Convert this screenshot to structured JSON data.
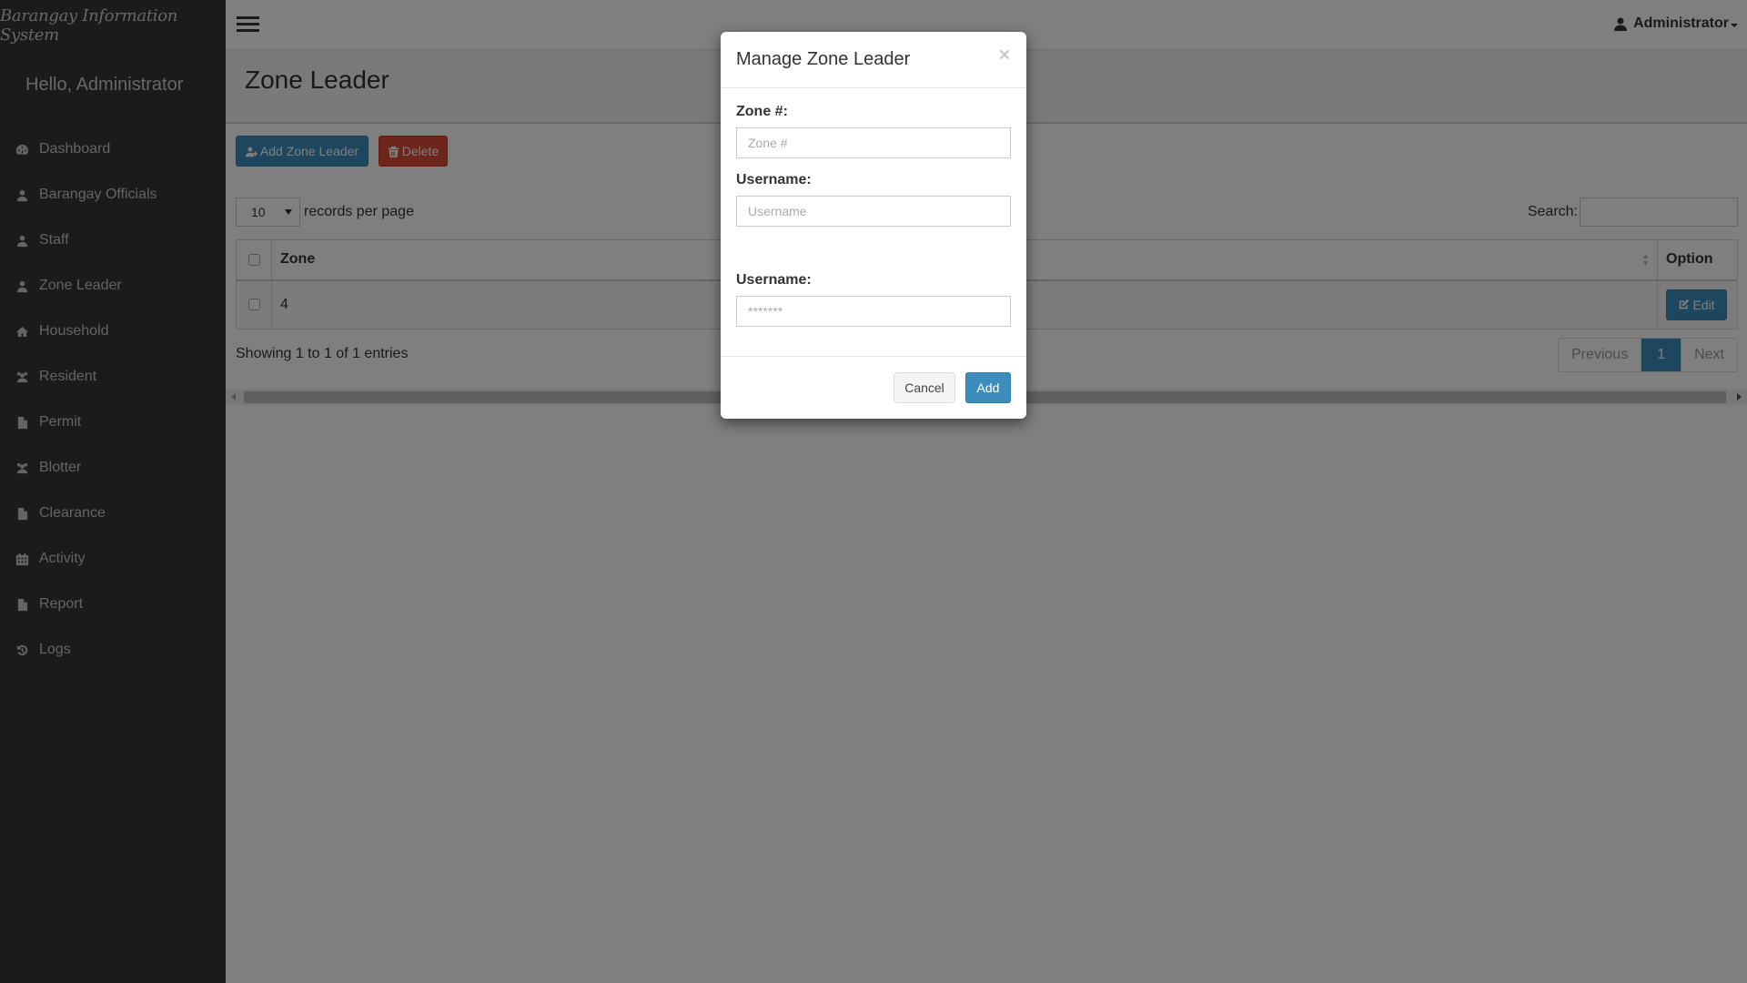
{
  "app": {
    "brand": "Barangay Information System",
    "greeting": "Hello, Administrator"
  },
  "sidebar": {
    "items": [
      {
        "label": "Dashboard",
        "icon": "dashboard-icon"
      },
      {
        "label": "Barangay Officials",
        "icon": "user-icon"
      },
      {
        "label": "Staff",
        "icon": "user-icon"
      },
      {
        "label": "Zone Leader",
        "icon": "user-icon"
      },
      {
        "label": "Household",
        "icon": "home-icon"
      },
      {
        "label": "Resident",
        "icon": "users-icon"
      },
      {
        "label": "Permit",
        "icon": "file-icon"
      },
      {
        "label": "Blotter",
        "icon": "users-icon"
      },
      {
        "label": "Clearance",
        "icon": "file-icon"
      },
      {
        "label": "Activity",
        "icon": "calendar-icon"
      },
      {
        "label": "Report",
        "icon": "file-icon"
      },
      {
        "label": "Logs",
        "icon": "history-icon"
      }
    ]
  },
  "topbar": {
    "user_label": "Administrator"
  },
  "page": {
    "title": "Zone Leader",
    "add_button": "Add Zone Leader",
    "delete_button": "Delete",
    "length_value": "10",
    "length_label": "records per page",
    "search_label": "Search:",
    "search_value": "",
    "table": {
      "columns": [
        "Zone",
        "Option"
      ],
      "rows": [
        {
          "zone": "4",
          "option": "Edit"
        }
      ]
    },
    "info": "Showing 1 to 1 of 1 entries",
    "pagination": {
      "previous": "Previous",
      "current": "1",
      "next": "Next"
    }
  },
  "modal": {
    "title": "Manage Zone Leader",
    "close": "×",
    "fields": [
      {
        "label": "Zone #:",
        "placeholder": "Zone #",
        "value": ""
      },
      {
        "label": "Username:",
        "placeholder": "Username",
        "value": ""
      },
      {
        "label": "Username:",
        "placeholder": "*******",
        "value": ""
      }
    ],
    "cancel": "Cancel",
    "submit": "Add"
  },
  "colors": {
    "primary": "#3c8dbc",
    "danger": "#dd4b39",
    "sidebar": "#363636"
  }
}
